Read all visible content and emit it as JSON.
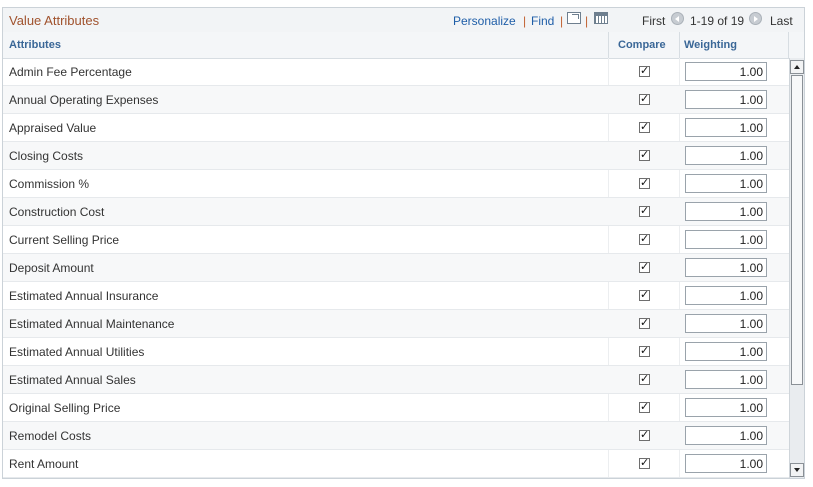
{
  "grid": {
    "title": "Value Attributes",
    "toolbar": {
      "personalize": "Personalize",
      "separator": "|",
      "find": "Find",
      "first": "First",
      "range": "1-19 of 19",
      "last": "Last",
      "zoom_icon": "view-all-icon",
      "download_icon": "download-icon",
      "prev_icon": "previous-arrow-icon",
      "next_icon": "next-arrow-icon"
    },
    "columns": {
      "attributes": "Attributes",
      "compare": "Compare",
      "weighting": "Weighting"
    },
    "rows": [
      {
        "name": "Admin Fee Percentage",
        "compare": true,
        "weighting": "1.00"
      },
      {
        "name": "Annual Operating Expenses",
        "compare": true,
        "weighting": "1.00"
      },
      {
        "name": "Appraised Value",
        "compare": true,
        "weighting": "1.00"
      },
      {
        "name": "Closing Costs",
        "compare": true,
        "weighting": "1.00"
      },
      {
        "name": "Commission %",
        "compare": true,
        "weighting": "1.00"
      },
      {
        "name": "Construction Cost",
        "compare": true,
        "weighting": "1.00"
      },
      {
        "name": "Current Selling Price",
        "compare": true,
        "weighting": "1.00"
      },
      {
        "name": "Deposit Amount",
        "compare": true,
        "weighting": "1.00"
      },
      {
        "name": "Estimated Annual Insurance",
        "compare": true,
        "weighting": "1.00"
      },
      {
        "name": "Estimated Annual Maintenance",
        "compare": true,
        "weighting": "1.00"
      },
      {
        "name": "Estimated Annual Utilities",
        "compare": true,
        "weighting": "1.00"
      },
      {
        "name": "Estimated Annual Sales",
        "compare": true,
        "weighting": "1.00"
      },
      {
        "name": "Original Selling Price",
        "compare": true,
        "weighting": "1.00"
      },
      {
        "name": "Remodel Costs",
        "compare": true,
        "weighting": "1.00"
      },
      {
        "name": "Rent Amount",
        "compare": true,
        "weighting": "1.00"
      }
    ],
    "colors": {
      "title": "#a0522d",
      "link": "#1f5ea8",
      "header_text": "#3a6797"
    }
  }
}
